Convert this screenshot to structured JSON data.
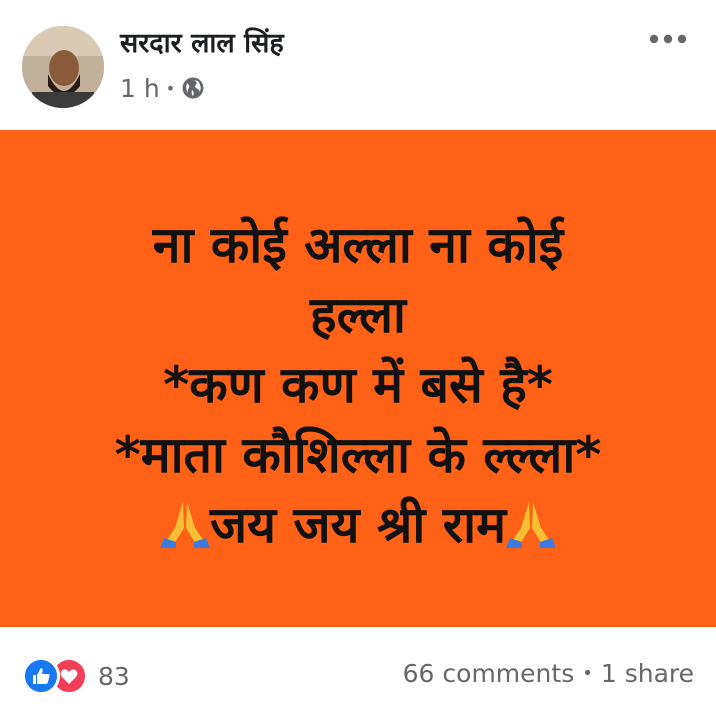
{
  "post": {
    "author": "सरदार लाल सिंह",
    "time": "1 h",
    "privacy_icon": "globe-icon",
    "more_icon": "more-options-icon"
  },
  "content": {
    "background_color": "#ff6117",
    "line1": "ना कोई अल्ला ना कोई",
    "line2": "हल्ला",
    "line3": "*कण कण में बसे है*",
    "line4": "*माता कौशिल्ला के ल्ल्ला*",
    "line5": "जय जय श्री राम",
    "emoji": "folded-hands-icon"
  },
  "footer": {
    "reaction_icons": [
      "like-icon",
      "love-icon"
    ],
    "reaction_count": "83",
    "comments": "66 comments",
    "shares": "1 share"
  }
}
